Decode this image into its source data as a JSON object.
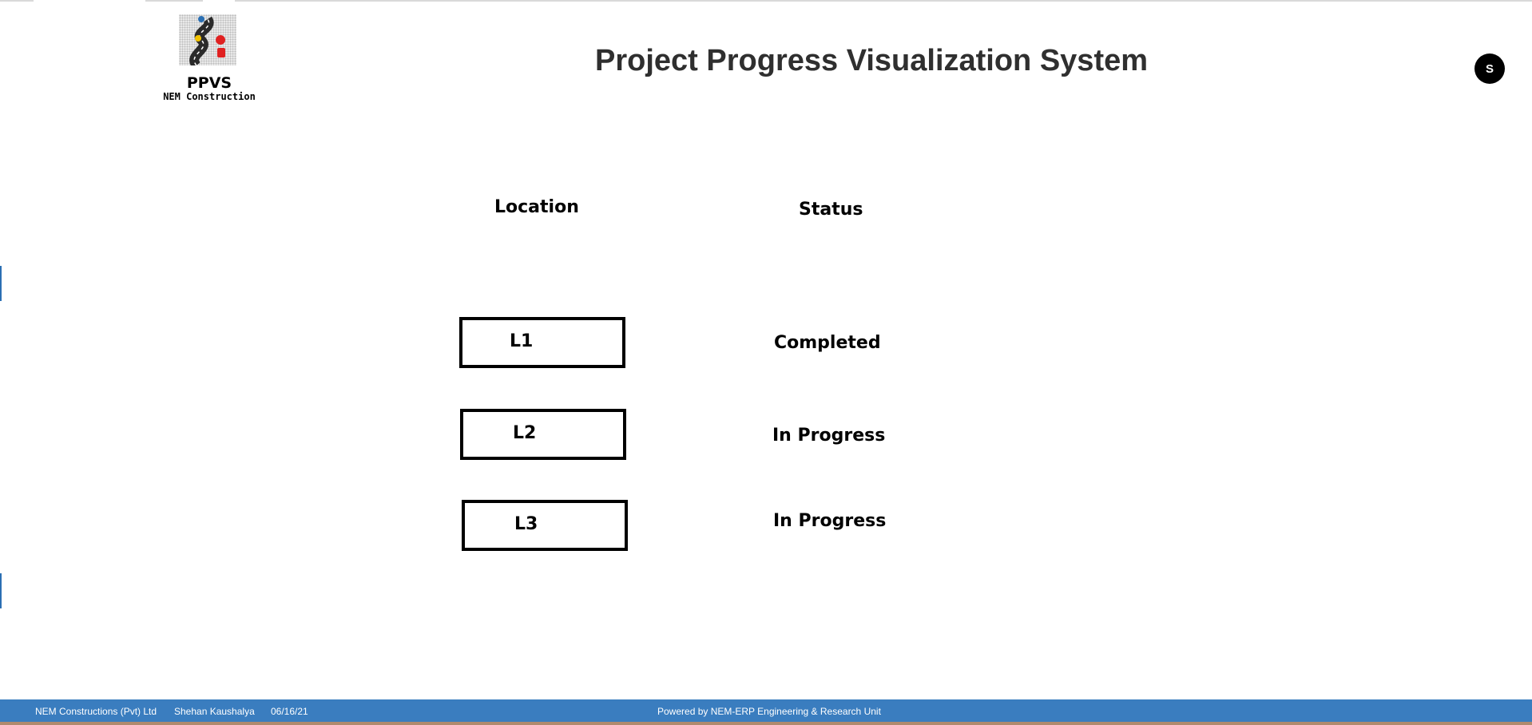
{
  "header": {
    "logo_title": "PPVS",
    "logo_subtitle": "NEM Construction",
    "page_title": "Project Progress Visualization System",
    "avatar_initial": "S"
  },
  "table": {
    "location_header": "Location",
    "status_header": "Status",
    "rows": [
      {
        "location": "L1",
        "status": "Completed"
      },
      {
        "location": "L2",
        "status": "In Progress"
      },
      {
        "location": "L3",
        "status": "In Progress"
      }
    ]
  },
  "footer": {
    "company": "NEM Constructions (Pvt) Ltd",
    "user": "Shehan Kaushalya",
    "date": "06/16/21",
    "powered_by": "Powered by NEM-ERP Engineering & Research Unit"
  },
  "colors": {
    "footer_bg": "#3a7dbf",
    "title_text": "#2f2f2f"
  }
}
